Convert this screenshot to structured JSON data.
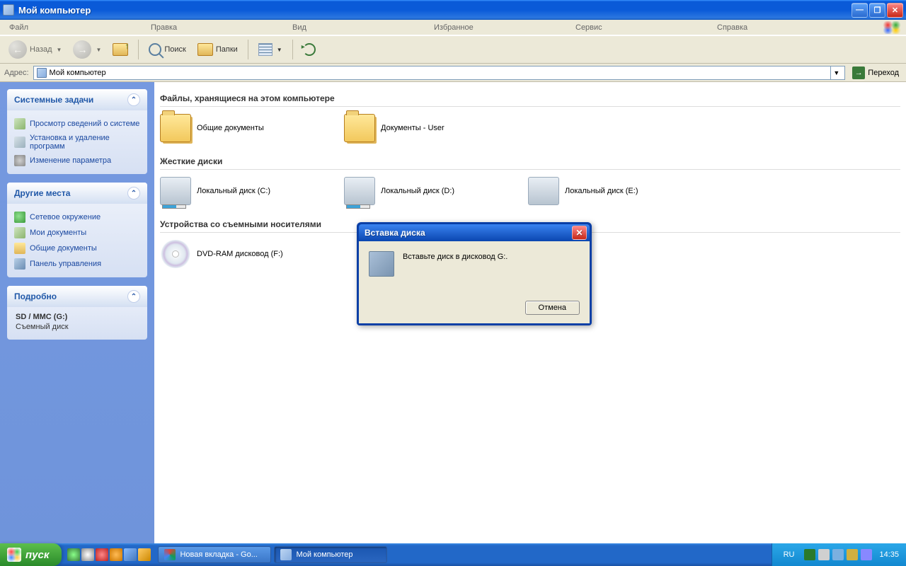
{
  "titlebar": {
    "title": "Мой компьютер"
  },
  "menubar": {
    "items": [
      "Файл",
      "Правка",
      "Вид",
      "Избранное",
      "Сервис",
      "Справка"
    ]
  },
  "toolbar": {
    "back": "Назад",
    "search": "Поиск",
    "folders": "Папки"
  },
  "addressbar": {
    "label": "Адрес:",
    "value": "Мой компьютер",
    "go": "Переход"
  },
  "panels": {
    "system": {
      "title": "Системные задачи",
      "links": [
        "Просмотр сведений о системе",
        "Установка и удаление программ",
        "Изменение параметра"
      ]
    },
    "places": {
      "title": "Другие места",
      "links": [
        "Сетевое окружение",
        "Мои документы",
        "Общие документы",
        "Панель управления"
      ]
    },
    "details": {
      "title": "Подробно",
      "name": "SD / MMC (G:)",
      "type": "Съемный диск"
    }
  },
  "content": {
    "sections": {
      "files": {
        "title": "Файлы, хранящиеся на этом компьютере",
        "items": [
          "Общие документы",
          "Документы - User"
        ]
      },
      "hdd": {
        "title": "Жесткие диски",
        "items": [
          "Локальный диск (C:)",
          "Локальный диск (D:)",
          "Локальный диск (E:)"
        ]
      },
      "removable": {
        "title": "Устройства со съемными носителями",
        "items": [
          "DVD-RAM дисковод (F:)"
        ]
      }
    }
  },
  "dialog": {
    "title": "Вставка диска",
    "message": "Вставьте диск в дисковод G:.",
    "cancel": "Отмена"
  },
  "taskbar": {
    "start": "пуск",
    "tasks": [
      "Новая вкладка - Go...",
      "Мой компьютер"
    ],
    "lang": "RU",
    "clock": "14:35"
  }
}
